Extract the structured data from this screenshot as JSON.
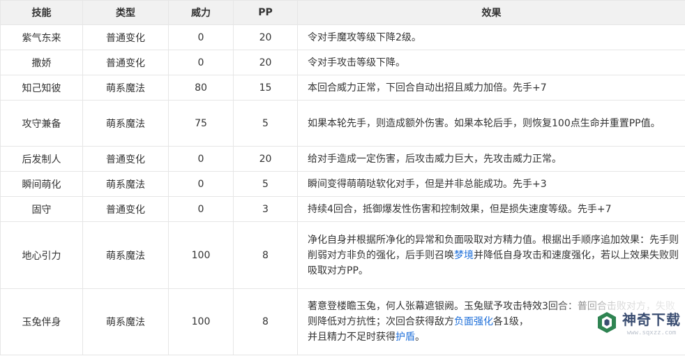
{
  "headers": [
    "技能",
    "类型",
    "威力",
    "PP",
    "效果"
  ],
  "rows": [
    {
      "name": "紫气东来",
      "type": "普通变化",
      "power": "0",
      "pp": "20",
      "effect": "令对手魔攻等级下降2级。"
    },
    {
      "name": "撒娇",
      "type": "普通变化",
      "power": "0",
      "pp": "20",
      "effect": "令对手攻击等级下降。"
    },
    {
      "name": "知己知彼",
      "type": "萌系魔法",
      "power": "80",
      "pp": "15",
      "effect": "本回合威力正常，下回合自动出招且威力加倍。先手+7"
    },
    {
      "name": "攻守兼备",
      "type": "萌系魔法",
      "power": "75",
      "pp": "5",
      "effect": "如果本轮先手，则造成额外伤害。如果本轮后手，则恢复100点生命并重置PP值。"
    },
    {
      "name": "后发制人",
      "type": "普通变化",
      "power": "0",
      "pp": "20",
      "effect": "给对手造成一定伤害，后攻击威力巨大，先攻击威力正常。"
    },
    {
      "name": "瞬间萌化",
      "type": "萌系魔法",
      "power": "0",
      "pp": "5",
      "effect": "瞬间变得萌萌哒软化对手，但是并非总能成功。先手+3"
    },
    {
      "name": "固守",
      "type": "普通变化",
      "power": "0",
      "pp": "3",
      "effect": "持续4回合，抵御爆发性伤害和控制效果，但是损失速度等级。先手+7"
    },
    {
      "name": "地心引力",
      "type": "萌系魔法",
      "power": "100",
      "pp": "8",
      "effect_parts": [
        "净化自身并根据所净化的异常和负面吸取对方精力值。根据出手顺序追加效果：先手则削弱对方非负的强化，后手则召唤",
        "梦境",
        "并降低自身攻击和速度强化，若以上效果失败则吸取对方PP。"
      ]
    },
    {
      "name": "玉兔伴身",
      "type": "萌系魔法",
      "power": "100",
      "pp": "8",
      "effect_parts": [
        "著意登楼瞻玉兔，何人张幕遮银阙。玉兔赋予攻击特效3回合：普回合击败对方，失败则降低对方抗性；次回合获得敌方",
        "负面强化",
        "各1级，",
        "并且精力不足时获得",
        "护盾",
        "。"
      ]
    }
  ],
  "watermark": {
    "title": "神奇下载",
    "url": "www.sqxzz.com"
  },
  "colors": {
    "header_bg": "#f1f1f1",
    "border": "#e6e6e6",
    "link": "#1e6fd9",
    "text": "#333333"
  }
}
